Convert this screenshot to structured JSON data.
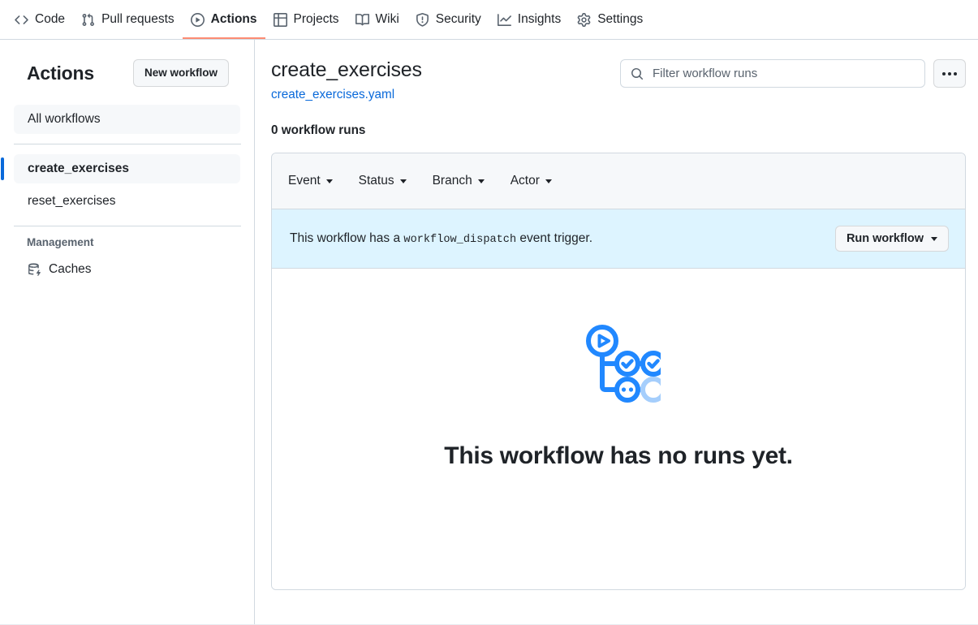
{
  "repo_nav": {
    "tabs": [
      {
        "label": "Code",
        "icon": "code-icon",
        "active": false
      },
      {
        "label": "Pull requests",
        "icon": "git-pull-request-icon",
        "active": false
      },
      {
        "label": "Actions",
        "icon": "play-circle-icon",
        "active": true
      },
      {
        "label": "Projects",
        "icon": "table-icon",
        "active": false
      },
      {
        "label": "Wiki",
        "icon": "book-icon",
        "active": false
      },
      {
        "label": "Security",
        "icon": "shield-icon",
        "active": false
      },
      {
        "label": "Insights",
        "icon": "graph-icon",
        "active": false
      },
      {
        "label": "Settings",
        "icon": "gear-icon",
        "active": false
      }
    ],
    "active_underline_color": "#fd8c73"
  },
  "sidebar": {
    "title": "Actions",
    "new_workflow_label": "New workflow",
    "all_workflows_label": "All workflows",
    "workflows": [
      {
        "label": "create_exercises",
        "current": true
      },
      {
        "label": "reset_exercises",
        "current": false
      }
    ],
    "management_label": "Management",
    "management_items": [
      {
        "label": "Caches",
        "icon": "cache-database-icon"
      }
    ],
    "current_indicator_color": "#0969da"
  },
  "main": {
    "workflow_title": "create_exercises",
    "workflow_file": "create_exercises.yaml",
    "workflow_file_color": "#0969da",
    "search": {
      "placeholder": "Filter workflow runs",
      "value": "",
      "icon": "search-icon"
    },
    "kebab_label": "More options",
    "runs_count_label": "0 workflow runs",
    "filters": [
      {
        "label": "Event"
      },
      {
        "label": "Status"
      },
      {
        "label": "Branch"
      },
      {
        "label": "Actor"
      }
    ],
    "dispatch_banner": {
      "text_before": "This workflow has a ",
      "code": "workflow_dispatch",
      "text_after": " event trigger.",
      "run_button_label": "Run workflow",
      "background_color": "#ddf4ff"
    },
    "empty_state": {
      "title": "This workflow has no runs yet.",
      "illustration": "workflow-runs-empty-illustration",
      "illustration_color": "#2188ff"
    }
  }
}
